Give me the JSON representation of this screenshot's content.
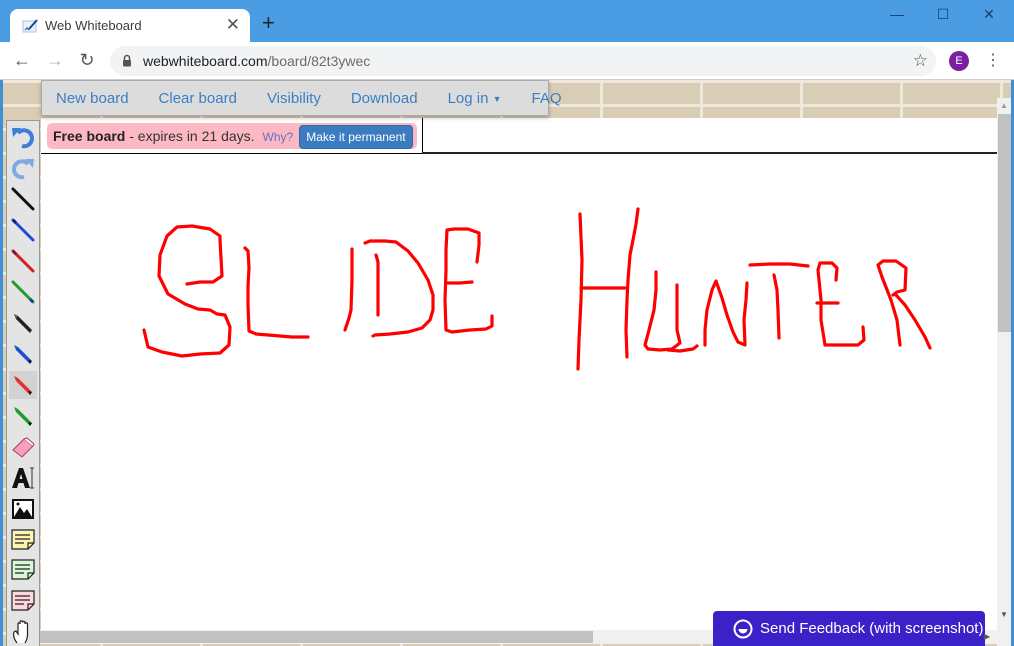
{
  "browser": {
    "tab_title": "Web Whiteboard",
    "new_tab_label": "+",
    "url_domain": "webwhiteboard.com",
    "url_path": "/board/82t3ywec",
    "profile_initial": "E",
    "profile_color": "#7b1fa2",
    "window_controls": {
      "minimize": "—",
      "maximize": "☐",
      "close": "✕"
    },
    "nav": {
      "back": "←",
      "forward": "→",
      "reload": "↻",
      "star": "☆",
      "menu": "⋮",
      "tab_close": "✕"
    }
  },
  "menu": {
    "items": [
      {
        "label": "New board"
      },
      {
        "label": "Clear board"
      },
      {
        "label": "Visibility"
      },
      {
        "label": "Download"
      },
      {
        "label": "Log in",
        "caret": "▼"
      },
      {
        "label": "FAQ"
      }
    ]
  },
  "notice": {
    "bold": "Free board",
    "text": " - expires in 21 days.",
    "why": "Why?",
    "button": "Make it permanent"
  },
  "tools": [
    {
      "name": "undo"
    },
    {
      "name": "redo"
    },
    {
      "name": "pen-black",
      "color": "#111111"
    },
    {
      "name": "pen-blue",
      "color": "#1a4fd0"
    },
    {
      "name": "pen-red",
      "color": "#d22020"
    },
    {
      "name": "pen-green",
      "color": "#1e9e2a"
    },
    {
      "name": "marker-black",
      "color": "#222222"
    },
    {
      "name": "marker-blue",
      "color": "#1a4fd0"
    },
    {
      "name": "marker-red",
      "color": "#e03030",
      "active": true
    },
    {
      "name": "marker-green",
      "color": "#1e9e2a"
    },
    {
      "name": "eraser"
    },
    {
      "name": "text"
    },
    {
      "name": "image"
    },
    {
      "name": "sticky-yellow",
      "color": "#fff3b0"
    },
    {
      "name": "sticky-green",
      "color": "#d8f8d8"
    },
    {
      "name": "sticky-pink",
      "color": "#ffd6dc"
    },
    {
      "name": "pan"
    }
  ],
  "drawing": {
    "stroke_color": "#ff0000",
    "words": [
      "SLIDE",
      "HUNTER"
    ]
  },
  "feedback": {
    "label": "Send Feedback (with screenshot)",
    "color": "#3a22c8"
  }
}
